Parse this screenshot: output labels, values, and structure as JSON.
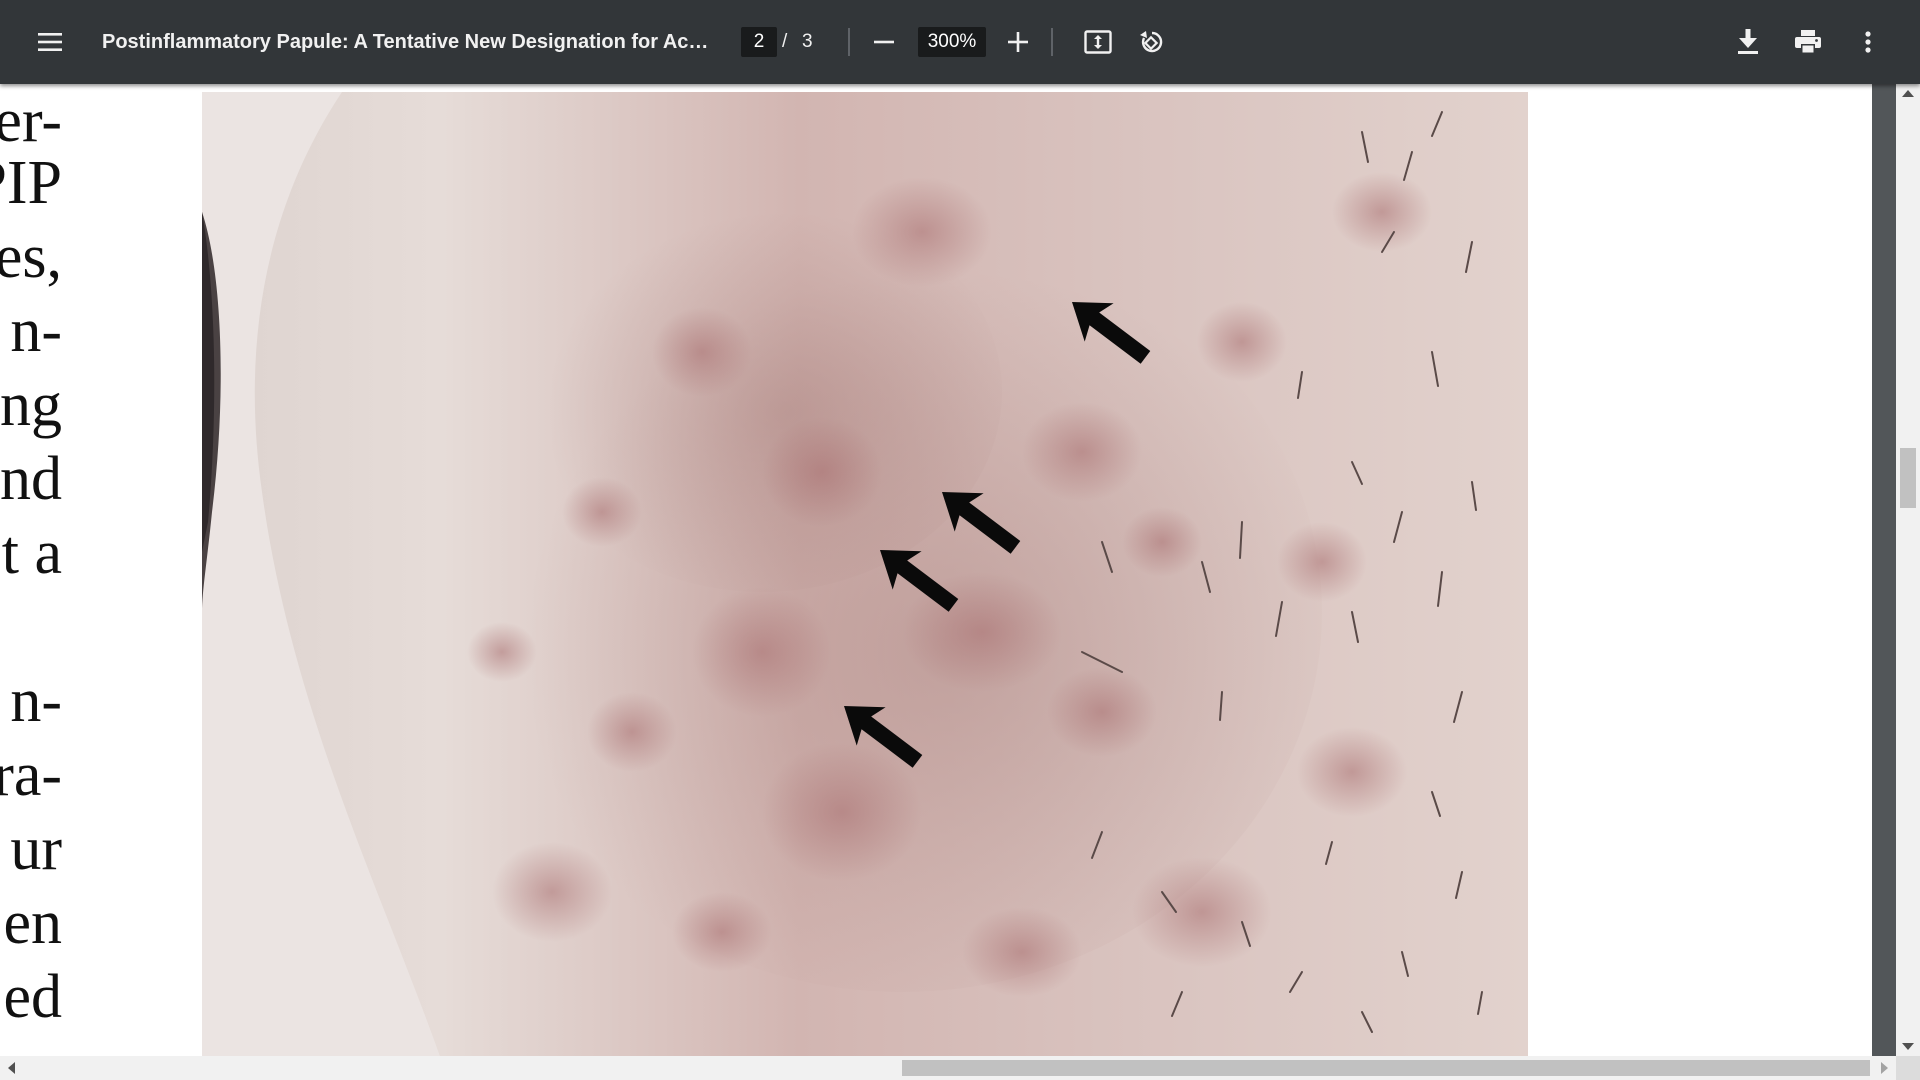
{
  "toolbar": {
    "title": "Postinflammatory Papule: A Tentative New Designation for Acne Lesions",
    "page_current": "2",
    "page_separator": "/",
    "page_total": "3",
    "zoom": "300%",
    "icons": {
      "menu": "menu-icon",
      "zoom_out": "minus-icon",
      "zoom_in": "plus-icon",
      "fit": "fit-to-page-icon",
      "rotate": "rotate-counterclockwise-icon",
      "download": "download-icon",
      "print": "print-icon",
      "more": "more-vert-icon"
    }
  },
  "document": {
    "left_column_fragments": [
      "er-",
      "PIP",
      "es,",
      "n-",
      "ng",
      "nd",
      "t a",
      "",
      "n-",
      "ra-",
      "ur",
      "en",
      "ed"
    ],
    "figure": {
      "description_icons": [
        "arrow-icon",
        "arrow-icon",
        "arrow-icon",
        "arrow-icon"
      ]
    }
  },
  "colors": {
    "toolbar_bg": "#323639",
    "viewer_bg": "#525659",
    "input_bg": "#191b1c",
    "page_bg": "#ffffff"
  }
}
